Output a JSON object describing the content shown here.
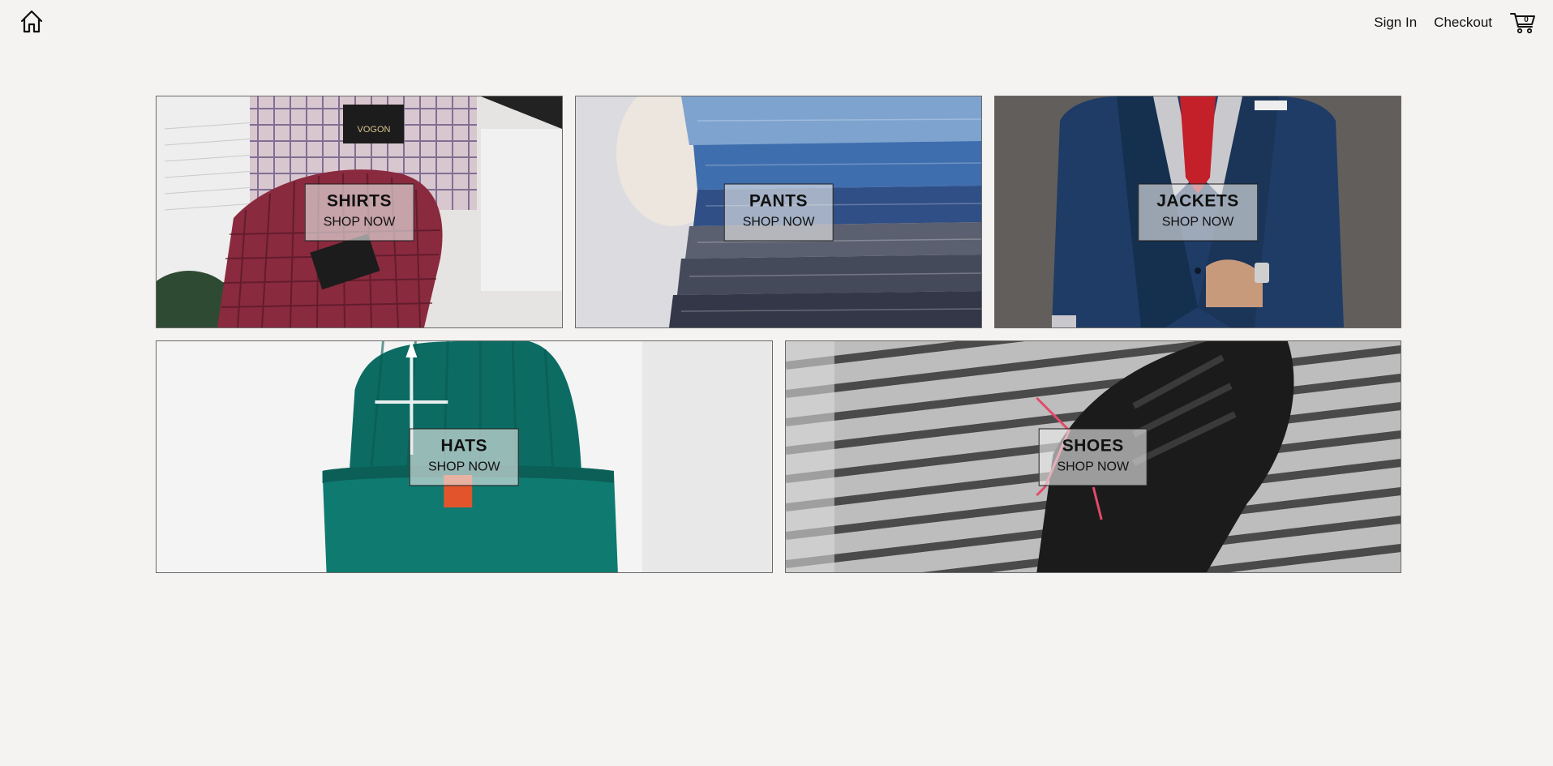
{
  "header": {
    "home_icon": "home-icon",
    "nav": {
      "sign_in": "Sign In",
      "checkout": "Checkout"
    },
    "cart": {
      "icon": "shopping-cart-icon",
      "count": "0"
    }
  },
  "categories": [
    {
      "title": "SHIRTS",
      "cta": "SHOP NOW"
    },
    {
      "title": "PANTS",
      "cta": "SHOP NOW"
    },
    {
      "title": "JACKETS",
      "cta": "SHOP NOW"
    },
    {
      "title": "HATS",
      "cta": "SHOP NOW"
    },
    {
      "title": "SHOES",
      "cta": "SHOP NOW"
    }
  ],
  "photo_text": {
    "shirt_label_brand": "VOGON"
  }
}
